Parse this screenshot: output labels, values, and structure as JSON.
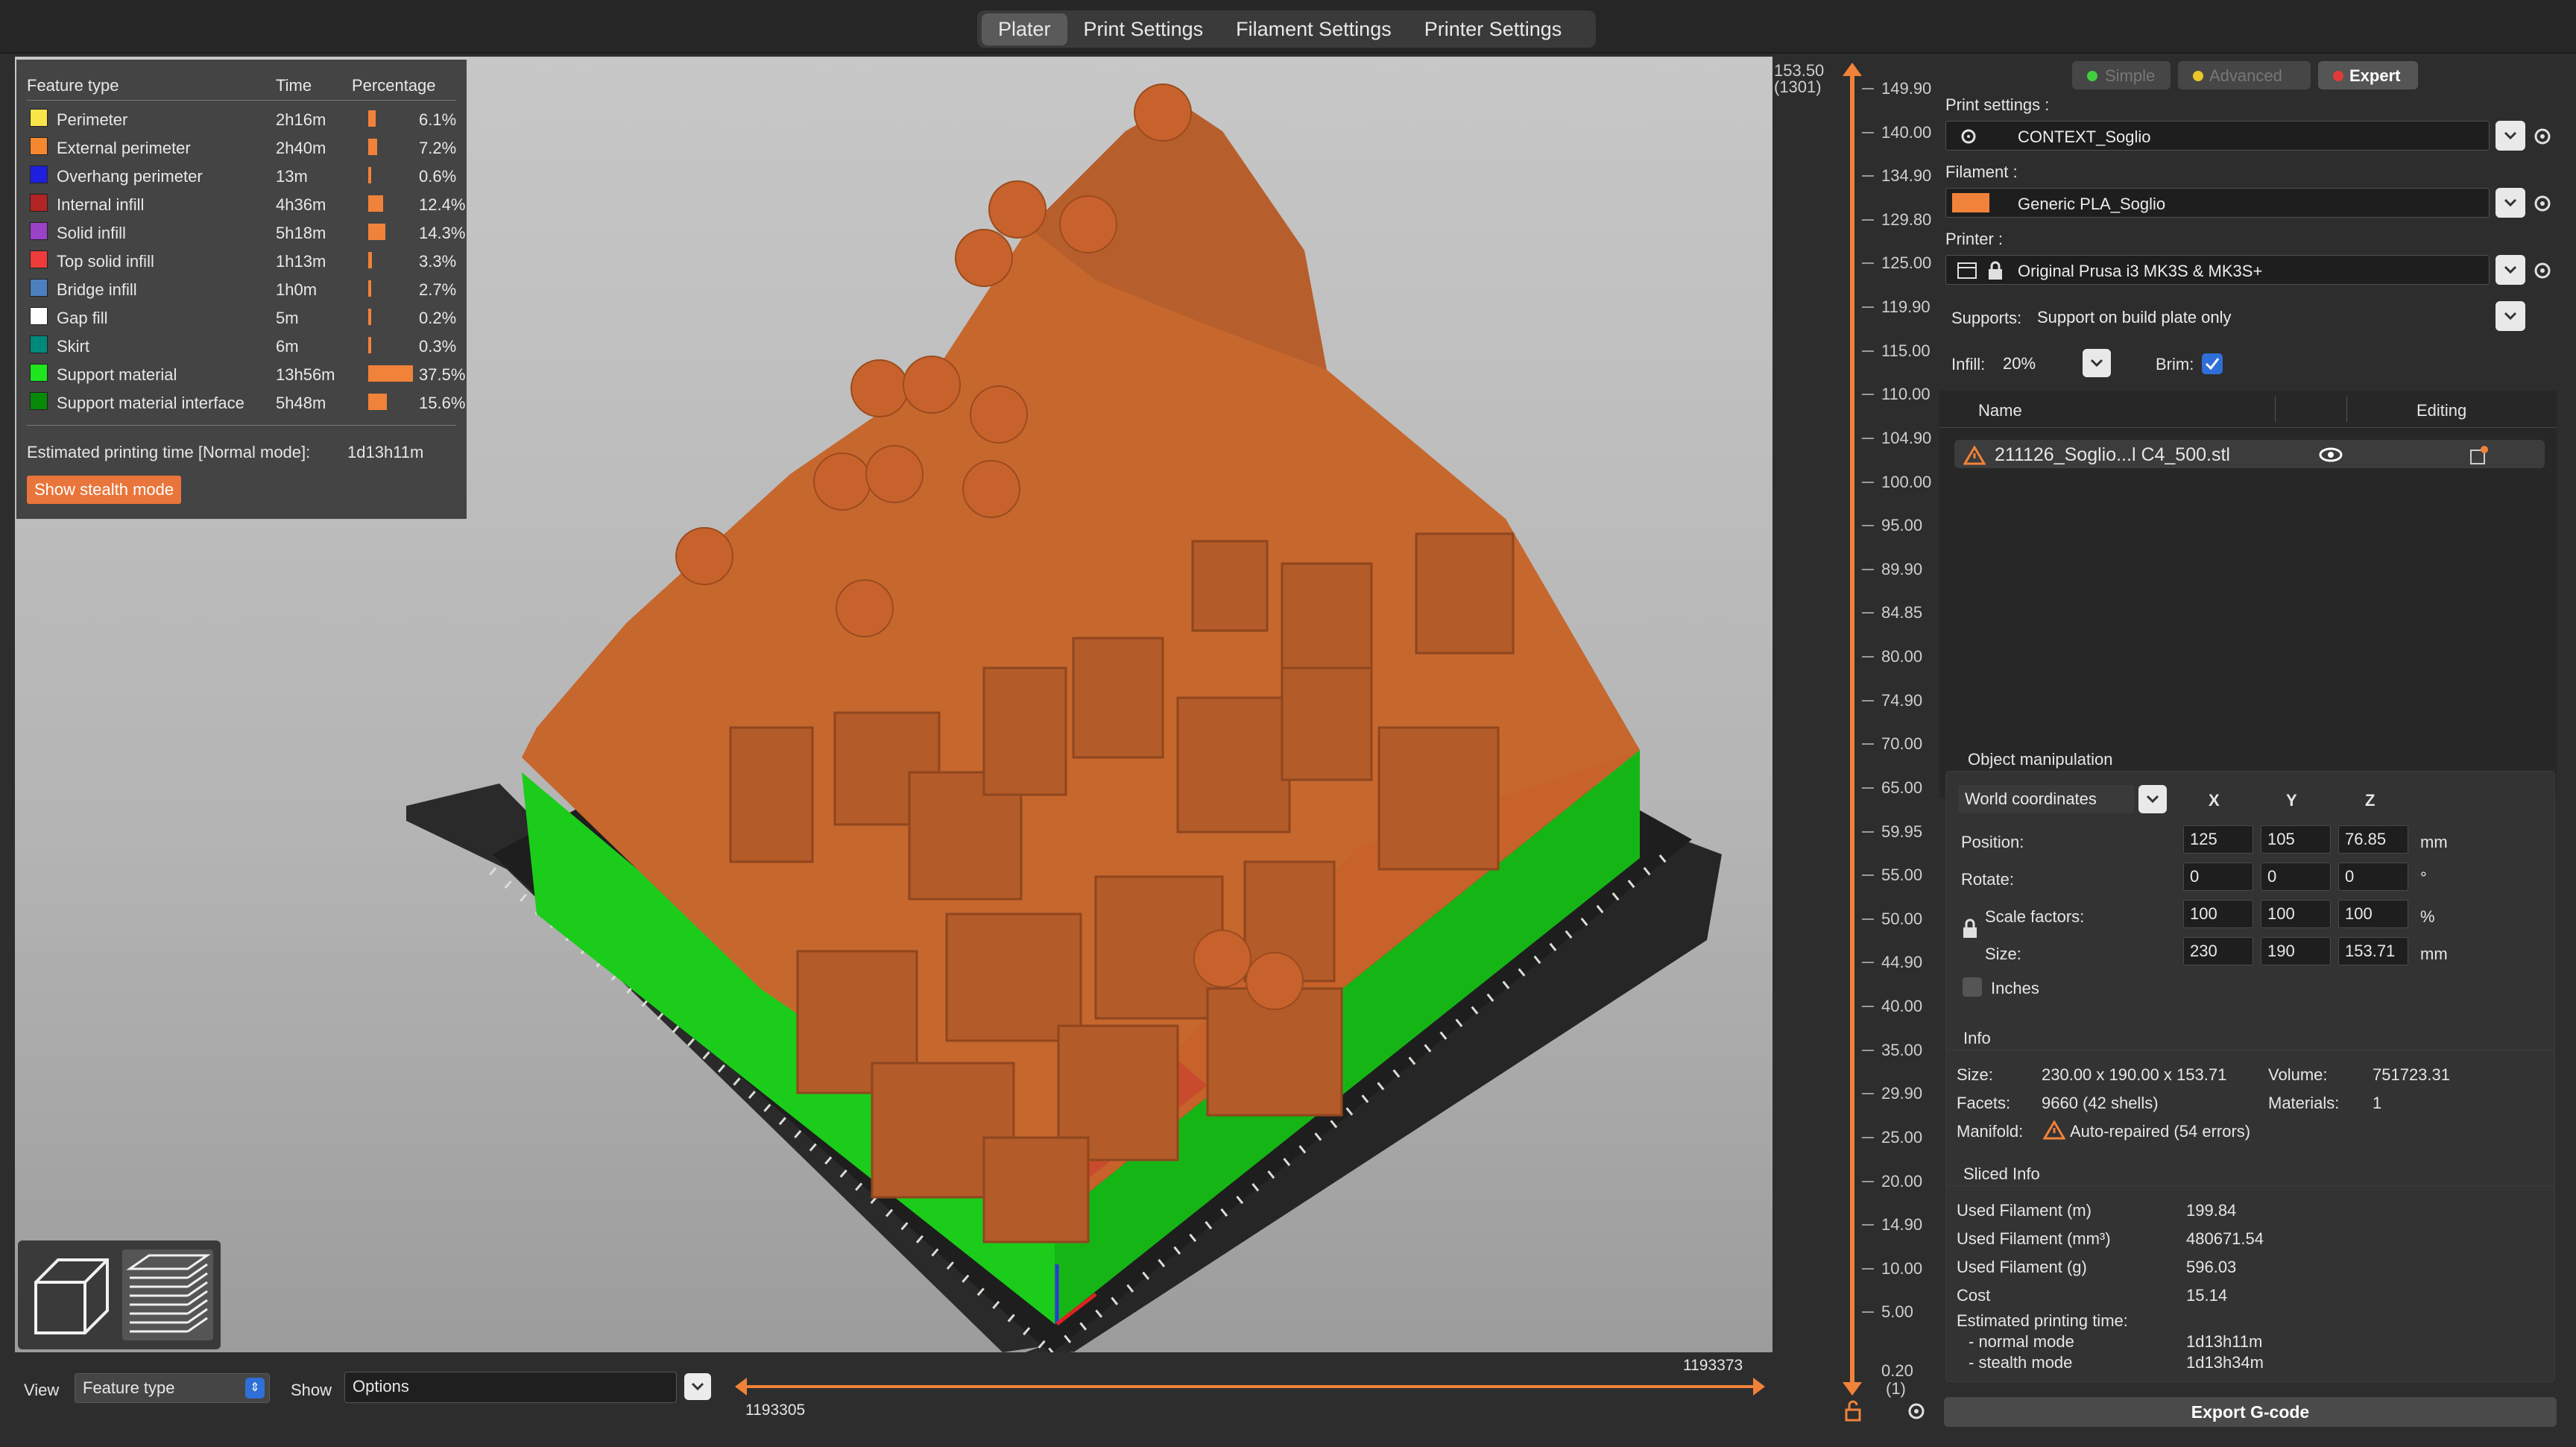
{
  "tabs": [
    "Plater",
    "Print Settings",
    "Filament Settings",
    "Printer Settings"
  ],
  "legend": {
    "headers": {
      "feature": "Feature type",
      "time": "Time",
      "percentage": "Percentage"
    },
    "rows": [
      {
        "label": "Perimeter",
        "time": "2h16m",
        "pct": "6.1%",
        "fraction": 0.061,
        "color": "#f9e547"
      },
      {
        "label": "External perimeter",
        "time": "2h40m",
        "pct": "7.2%",
        "fraction": 0.072,
        "color": "#f5882f"
      },
      {
        "label": "Overhang perimeter",
        "time": "13m",
        "pct": "0.6%",
        "fraction": 0.006,
        "color": "#1f1fe0"
      },
      {
        "label": "Internal infill",
        "time": "4h36m",
        "pct": "12.4%",
        "fraction": 0.124,
        "color": "#b32424"
      },
      {
        "label": "Solid infill",
        "time": "5h18m",
        "pct": "14.3%",
        "fraction": 0.143,
        "color": "#9b42c8"
      },
      {
        "label": "Top solid infill",
        "time": "1h13m",
        "pct": "3.3%",
        "fraction": 0.033,
        "color": "#ef3b3b"
      },
      {
        "label": "Bridge infill",
        "time": "1h0m",
        "pct": "2.7%",
        "fraction": 0.027,
        "color": "#4d7fbf"
      },
      {
        "label": "Gap fill",
        "time": "5m",
        "pct": "0.2%",
        "fraction": 0.002,
        "color": "#ffffff"
      },
      {
        "label": "Skirt",
        "time": "6m",
        "pct": "0.3%",
        "fraction": 0.003,
        "color": "#00897b"
      },
      {
        "label": "Support material",
        "time": "13h56m",
        "pct": "37.5%",
        "fraction": 0.375,
        "color": "#1ee51e"
      },
      {
        "label": "Support material interface",
        "time": "5h48m",
        "pct": "15.6%",
        "fraction": 0.156,
        "color": "#078a07"
      }
    ],
    "estimate_label": "Estimated printing time [Normal mode]:",
    "estimate_value": "1d13h11m",
    "stealth_button": "Show stealth mode"
  },
  "bottom": {
    "view_label": "View",
    "view_value": "Feature type",
    "show_label": "Show",
    "show_value": "Options",
    "hslider_right": "1193373",
    "hslider_left": "1193305"
  },
  "vslider": {
    "top_value": "153.50",
    "top_layer": "(1301)",
    "bottom_value": "0.20",
    "bottom_layer": "(1)",
    "ticks": [
      "149.90",
      "140.00",
      "134.90",
      "129.80",
      "125.00",
      "119.90",
      "115.00",
      "110.00",
      "104.90",
      "100.00",
      "95.00",
      "89.90",
      "84.85",
      "80.00",
      "74.90",
      "70.00",
      "65.00",
      "59.95",
      "55.00",
      "50.00",
      "44.90",
      "40.00",
      "35.00",
      "29.90",
      "25.00",
      "20.00",
      "14.90",
      "10.00",
      "5.00"
    ]
  },
  "mode": {
    "simple": "Simple",
    "advanced": "Advanced",
    "expert": "Expert"
  },
  "settings": {
    "print_label": "Print settings :",
    "print_value": "CONTEXT_Soglio",
    "filament_label": "Filament :",
    "filament_value": "Generic PLA_Soglio",
    "filament_color": "#f0823a",
    "printer_label": "Printer :",
    "printer_value": "Original Prusa i3 MK3S & MK3S+",
    "supports_label": "Supports:",
    "supports_value": "Support on build plate only",
    "infill_label": "Infill:",
    "infill_value": "20%",
    "brim_label": "Brim:"
  },
  "objects": {
    "col_name": "Name",
    "col_editing": "Editing",
    "item": "211126_Soglio...l C4_500.stl"
  },
  "manip": {
    "title": "Object manipulation",
    "coords": "World coordinates",
    "x": "X",
    "y": "Y",
    "z": "Z",
    "position_label": "Position:",
    "position": [
      "125",
      "105",
      "76.85"
    ],
    "position_unit": "mm",
    "rotate_label": "Rotate:",
    "rotate": [
      "0",
      "0",
      "0"
    ],
    "rotate_unit": "°",
    "scale_label": "Scale factors:",
    "scale": [
      "100",
      "100",
      "100"
    ],
    "scale_unit": "%",
    "size_label": "Size:",
    "size": [
      "230",
      "190",
      "153.71"
    ],
    "size_unit": "mm",
    "inches_label": "Inches"
  },
  "info": {
    "title": "Info",
    "size_label": "Size:",
    "size_value": "230.00 x 190.00 x 153.71",
    "volume_label": "Volume:",
    "volume_value": "751723.31",
    "facets_label": "Facets:",
    "facets_value": "9660 (42 shells)",
    "materials_label": "Materials:",
    "materials_value": "1",
    "manifold_label": "Manifold:",
    "manifold_value": "Auto-repaired (54 errors)"
  },
  "sliced": {
    "title": "Sliced Info",
    "rows": [
      {
        "label": "Used Filament (m)",
        "value": "199.84"
      },
      {
        "label": "Used Filament (mm³)",
        "value": "480671.54"
      },
      {
        "label": "Used Filament (g)",
        "value": "596.03"
      },
      {
        "label": "Cost",
        "value": "15.14"
      }
    ],
    "est_label": "Estimated printing time:",
    "normal_label": "- normal mode",
    "normal_value": "1d13h11m",
    "stealth_label": "- stealth mode",
    "stealth_value": "1d13h34m"
  },
  "export_button": "Export G-code"
}
